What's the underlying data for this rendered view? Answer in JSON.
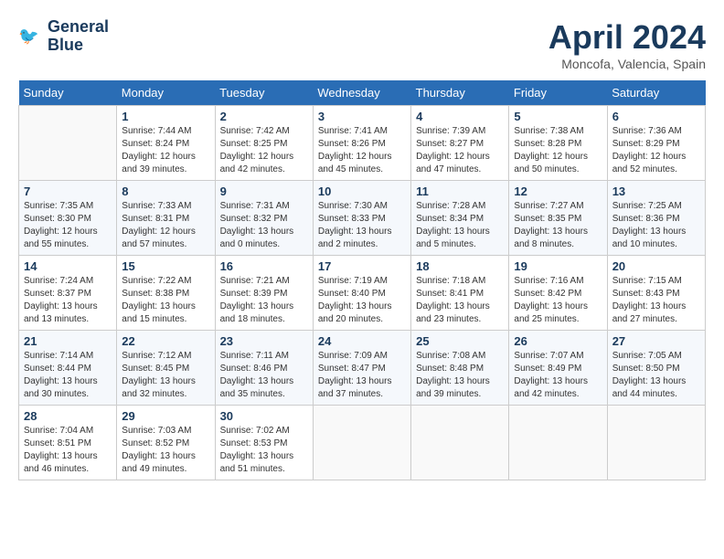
{
  "logo": {
    "line1": "General",
    "line2": "Blue"
  },
  "title": "April 2024",
  "location": "Moncofa, Valencia, Spain",
  "days_header": [
    "Sunday",
    "Monday",
    "Tuesday",
    "Wednesday",
    "Thursday",
    "Friday",
    "Saturday"
  ],
  "weeks": [
    [
      {
        "num": "",
        "info": ""
      },
      {
        "num": "1",
        "info": "Sunrise: 7:44 AM\nSunset: 8:24 PM\nDaylight: 12 hours\nand 39 minutes."
      },
      {
        "num": "2",
        "info": "Sunrise: 7:42 AM\nSunset: 8:25 PM\nDaylight: 12 hours\nand 42 minutes."
      },
      {
        "num": "3",
        "info": "Sunrise: 7:41 AM\nSunset: 8:26 PM\nDaylight: 12 hours\nand 45 minutes."
      },
      {
        "num": "4",
        "info": "Sunrise: 7:39 AM\nSunset: 8:27 PM\nDaylight: 12 hours\nand 47 minutes."
      },
      {
        "num": "5",
        "info": "Sunrise: 7:38 AM\nSunset: 8:28 PM\nDaylight: 12 hours\nand 50 minutes."
      },
      {
        "num": "6",
        "info": "Sunrise: 7:36 AM\nSunset: 8:29 PM\nDaylight: 12 hours\nand 52 minutes."
      }
    ],
    [
      {
        "num": "7",
        "info": "Sunrise: 7:35 AM\nSunset: 8:30 PM\nDaylight: 12 hours\nand 55 minutes."
      },
      {
        "num": "8",
        "info": "Sunrise: 7:33 AM\nSunset: 8:31 PM\nDaylight: 12 hours\nand 57 minutes."
      },
      {
        "num": "9",
        "info": "Sunrise: 7:31 AM\nSunset: 8:32 PM\nDaylight: 13 hours\nand 0 minutes."
      },
      {
        "num": "10",
        "info": "Sunrise: 7:30 AM\nSunset: 8:33 PM\nDaylight: 13 hours\nand 2 minutes."
      },
      {
        "num": "11",
        "info": "Sunrise: 7:28 AM\nSunset: 8:34 PM\nDaylight: 13 hours\nand 5 minutes."
      },
      {
        "num": "12",
        "info": "Sunrise: 7:27 AM\nSunset: 8:35 PM\nDaylight: 13 hours\nand 8 minutes."
      },
      {
        "num": "13",
        "info": "Sunrise: 7:25 AM\nSunset: 8:36 PM\nDaylight: 13 hours\nand 10 minutes."
      }
    ],
    [
      {
        "num": "14",
        "info": "Sunrise: 7:24 AM\nSunset: 8:37 PM\nDaylight: 13 hours\nand 13 minutes."
      },
      {
        "num": "15",
        "info": "Sunrise: 7:22 AM\nSunset: 8:38 PM\nDaylight: 13 hours\nand 15 minutes."
      },
      {
        "num": "16",
        "info": "Sunrise: 7:21 AM\nSunset: 8:39 PM\nDaylight: 13 hours\nand 18 minutes."
      },
      {
        "num": "17",
        "info": "Sunrise: 7:19 AM\nSunset: 8:40 PM\nDaylight: 13 hours\nand 20 minutes."
      },
      {
        "num": "18",
        "info": "Sunrise: 7:18 AM\nSunset: 8:41 PM\nDaylight: 13 hours\nand 23 minutes."
      },
      {
        "num": "19",
        "info": "Sunrise: 7:16 AM\nSunset: 8:42 PM\nDaylight: 13 hours\nand 25 minutes."
      },
      {
        "num": "20",
        "info": "Sunrise: 7:15 AM\nSunset: 8:43 PM\nDaylight: 13 hours\nand 27 minutes."
      }
    ],
    [
      {
        "num": "21",
        "info": "Sunrise: 7:14 AM\nSunset: 8:44 PM\nDaylight: 13 hours\nand 30 minutes."
      },
      {
        "num": "22",
        "info": "Sunrise: 7:12 AM\nSunset: 8:45 PM\nDaylight: 13 hours\nand 32 minutes."
      },
      {
        "num": "23",
        "info": "Sunrise: 7:11 AM\nSunset: 8:46 PM\nDaylight: 13 hours\nand 35 minutes."
      },
      {
        "num": "24",
        "info": "Sunrise: 7:09 AM\nSunset: 8:47 PM\nDaylight: 13 hours\nand 37 minutes."
      },
      {
        "num": "25",
        "info": "Sunrise: 7:08 AM\nSunset: 8:48 PM\nDaylight: 13 hours\nand 39 minutes."
      },
      {
        "num": "26",
        "info": "Sunrise: 7:07 AM\nSunset: 8:49 PM\nDaylight: 13 hours\nand 42 minutes."
      },
      {
        "num": "27",
        "info": "Sunrise: 7:05 AM\nSunset: 8:50 PM\nDaylight: 13 hours\nand 44 minutes."
      }
    ],
    [
      {
        "num": "28",
        "info": "Sunrise: 7:04 AM\nSunset: 8:51 PM\nDaylight: 13 hours\nand 46 minutes."
      },
      {
        "num": "29",
        "info": "Sunrise: 7:03 AM\nSunset: 8:52 PM\nDaylight: 13 hours\nand 49 minutes."
      },
      {
        "num": "30",
        "info": "Sunrise: 7:02 AM\nSunset: 8:53 PM\nDaylight: 13 hours\nand 51 minutes."
      },
      {
        "num": "",
        "info": ""
      },
      {
        "num": "",
        "info": ""
      },
      {
        "num": "",
        "info": ""
      },
      {
        "num": "",
        "info": ""
      }
    ]
  ]
}
